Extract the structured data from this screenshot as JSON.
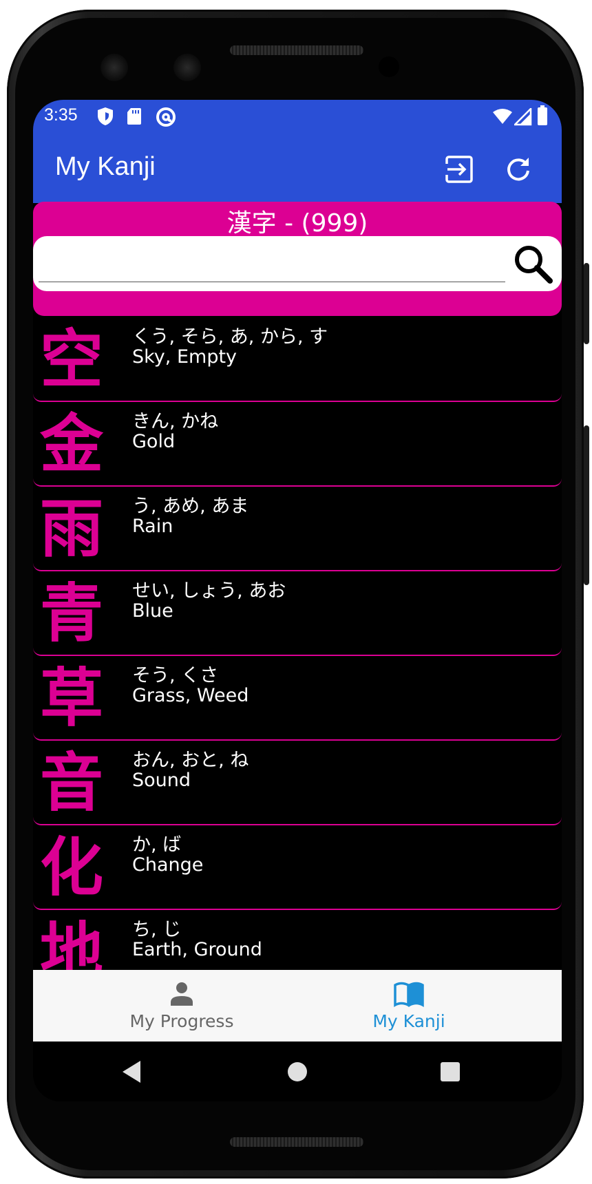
{
  "status_bar": {
    "time": "3:35"
  },
  "app_bar": {
    "title": "My Kanji",
    "actions": [
      "login-icon",
      "refresh-icon"
    ]
  },
  "header": {
    "title": "漢字 - (999)",
    "search_value": "",
    "search_placeholder": ""
  },
  "kanji_list": [
    {
      "kanji": "空",
      "readings": "くう, そら, あ, から, す",
      "meaning": "Sky, Empty"
    },
    {
      "kanji": "金",
      "readings": "きん, かね",
      "meaning": "Gold"
    },
    {
      "kanji": "雨",
      "readings": "う, あめ, あま",
      "meaning": "Rain"
    },
    {
      "kanji": "青",
      "readings": "せい, しょう, あお",
      "meaning": "Blue"
    },
    {
      "kanji": "草",
      "readings": "そう, くさ",
      "meaning": "Grass, Weed"
    },
    {
      "kanji": "音",
      "readings": "おん, おと, ね",
      "meaning": "Sound"
    },
    {
      "kanji": "化",
      "readings": "か, ば",
      "meaning": "Change"
    },
    {
      "kanji": "地",
      "readings": "ち, じ",
      "meaning": "Earth, Ground"
    }
  ],
  "bottom_nav": {
    "items": [
      {
        "label": "My Progress",
        "icon": "person-icon",
        "active": false
      },
      {
        "label": "My Kanji",
        "icon": "book-icon",
        "active": true
      }
    ]
  },
  "colors": {
    "app_bar": "#2a4fd6",
    "accent": "#dc0093",
    "nav_active": "#1e90d6",
    "nav_inactive": "#666666"
  }
}
